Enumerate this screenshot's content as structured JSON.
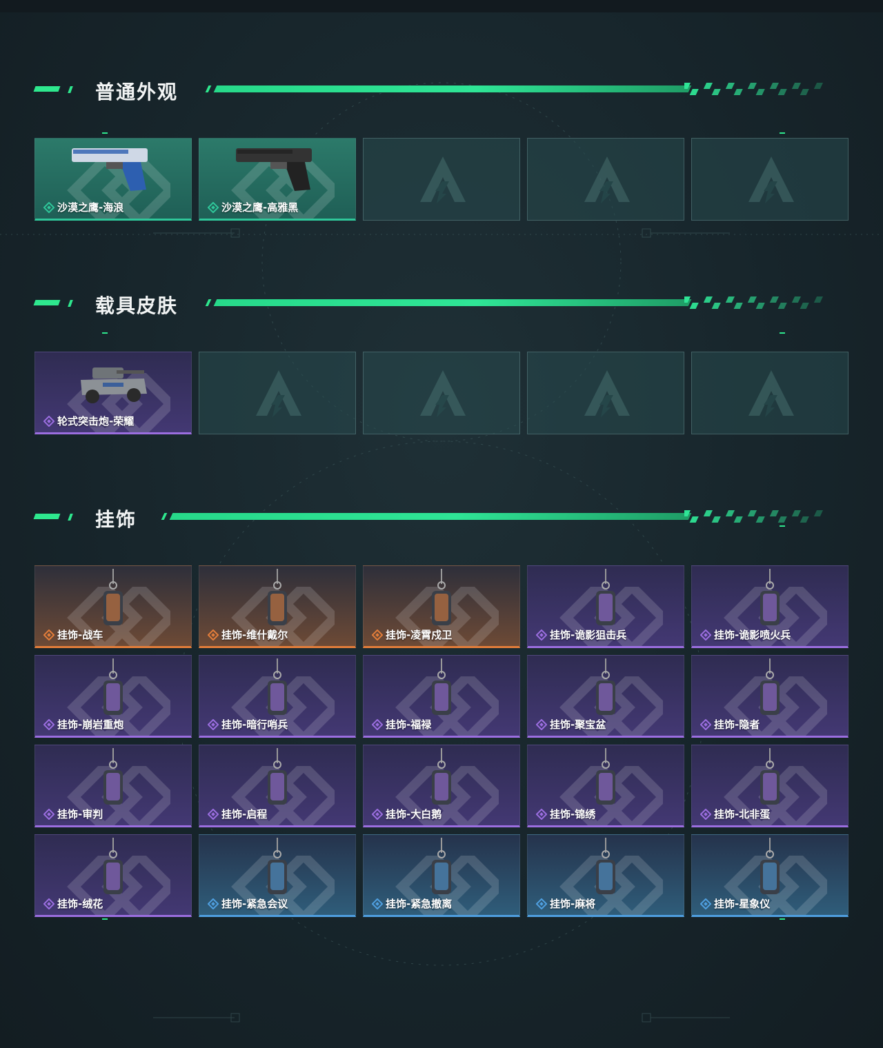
{
  "sections": [
    {
      "title": "普通外观",
      "items": [
        {
          "label": "沙漠之鹰-海浪",
          "rarity": "green",
          "icon": "blue-pistol-icon"
        },
        {
          "label": "沙漠之鹰-高雅黑",
          "rarity": "green",
          "icon": "black-pistol-icon"
        },
        {
          "label": "",
          "rarity": "empty"
        },
        {
          "label": "",
          "rarity": "empty"
        },
        {
          "label": "",
          "rarity": "empty"
        }
      ]
    },
    {
      "title": "载具皮肤",
      "items": [
        {
          "label": "轮式突击炮-荣耀",
          "rarity": "purple",
          "icon": "armored-vehicle-icon"
        },
        {
          "label": "",
          "rarity": "empty"
        },
        {
          "label": "",
          "rarity": "empty"
        },
        {
          "label": "",
          "rarity": "empty"
        },
        {
          "label": "",
          "rarity": "empty"
        }
      ]
    },
    {
      "title": "挂饰",
      "items": [
        {
          "label": "挂饰-战车",
          "rarity": "orange",
          "icon": "card-charm-icon"
        },
        {
          "label": "挂饰-维什戴尔",
          "rarity": "orange",
          "icon": "tag-charm-icon"
        },
        {
          "label": "挂饰-凌霄戍卫",
          "rarity": "orange",
          "icon": "bird-charm-icon"
        },
        {
          "label": "挂饰-诡影狙击兵",
          "rarity": "purple",
          "icon": "duck-charm-icon"
        },
        {
          "label": "挂饰-诡影喷火兵",
          "rarity": "purple",
          "icon": "soldier-charm-icon"
        },
        {
          "label": "挂饰-崩岩重炮",
          "rarity": "purple",
          "icon": "helmet-charm-icon"
        },
        {
          "label": "挂饰-暗行哨兵",
          "rarity": "purple",
          "icon": "scout-charm-icon"
        },
        {
          "label": "挂饰-福禄",
          "rarity": "purple",
          "icon": "gourd-charm-icon"
        },
        {
          "label": "挂饰-聚宝盆",
          "rarity": "purple",
          "icon": "treasure-bowl-charm-icon"
        },
        {
          "label": "挂饰-隐者",
          "rarity": "purple",
          "icon": "tarot-charm-icon"
        },
        {
          "label": "挂饰-审判",
          "rarity": "purple",
          "icon": "judgement-card-charm-icon"
        },
        {
          "label": "挂饰-启程",
          "rarity": "purple",
          "icon": "ring-charm-icon"
        },
        {
          "label": "挂饰-大白鹅",
          "rarity": "purple",
          "icon": "goose-charm-icon"
        },
        {
          "label": "挂饰-锦绣",
          "rarity": "purple",
          "icon": "butterfly-charm-icon"
        },
        {
          "label": "挂饰-北非蛋",
          "rarity": "purple",
          "icon": "egg-dish-charm-icon"
        },
        {
          "label": "挂饰-绒花",
          "rarity": "purple",
          "icon": "rose-charm-icon"
        },
        {
          "label": "挂饰-紧急会议",
          "rarity": "blue",
          "icon": "badge-charm-icon"
        },
        {
          "label": "挂饰-紧急撤离",
          "rarity": "blue",
          "icon": "exit-sign-charm-icon"
        },
        {
          "label": "挂饰-麻将",
          "rarity": "blue",
          "icon": "mahjong-tile-charm-icon"
        },
        {
          "label": "挂饰-星象仪",
          "rarity": "blue",
          "icon": "astrolabe-charm-icon"
        }
      ]
    }
  ],
  "colors": {
    "accent": "#2ee88e",
    "green": "#2fc79a",
    "purple": "#9b6ee0",
    "orange": "#e27d3a",
    "blue": "#4f9fe0"
  }
}
